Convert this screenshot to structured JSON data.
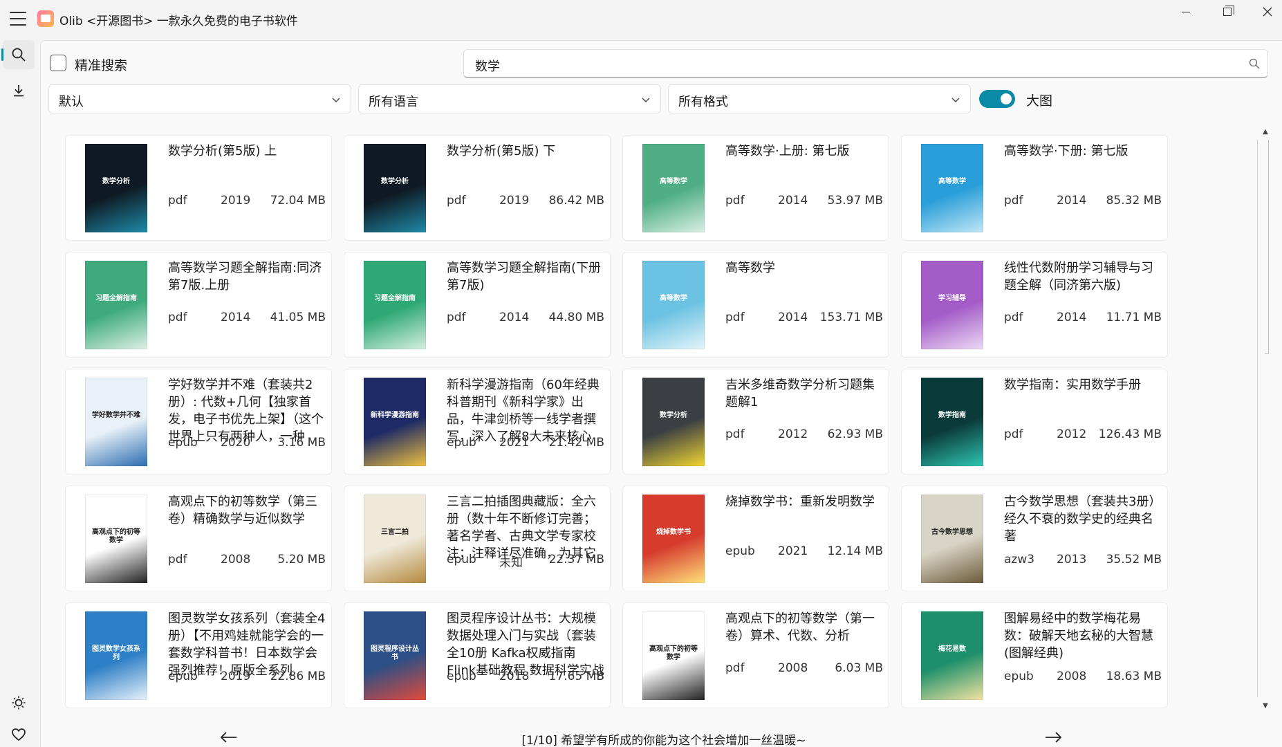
{
  "window": {
    "title": "Olib <开源图书> 一款永久免费的电子书软件",
    "controls": [
      "minimize",
      "maximize",
      "close"
    ]
  },
  "sidebar": {
    "top_items": [
      {
        "icon": "search-icon",
        "active": true
      },
      {
        "icon": "download-icon",
        "active": false
      }
    ],
    "bottom_items": [
      {
        "icon": "theme-icon"
      },
      {
        "icon": "heart-icon"
      },
      {
        "icon": "gear-icon"
      }
    ]
  },
  "filters": {
    "exact_search_label": "精准搜索",
    "exact_search_checked": false,
    "search_value": "数学",
    "sort_selected": "默认",
    "language_selected": "所有语言",
    "format_selected": "所有格式",
    "large_image_label": "大图",
    "large_image_on": true
  },
  "books": [
    {
      "title": "数学分析(第5版) 上",
      "format": "pdf",
      "year": "2019",
      "size": "72.04 MB",
      "cover_color": "#0f1a24",
      "cover_accent": "#1e8aa8",
      "cover_text": "数学分析"
    },
    {
      "title": "数学分析(第5版) 下",
      "format": "pdf",
      "year": "2019",
      "size": "86.42 MB",
      "cover_color": "#0f1a24",
      "cover_accent": "#1e8aa8",
      "cover_text": "数学分析"
    },
    {
      "title": "高等数学·上册: 第七版",
      "format": "pdf",
      "year": "2014",
      "size": "53.97 MB",
      "cover_color": "#4fae84",
      "cover_accent": "#d9efe4",
      "cover_text": "高等数学"
    },
    {
      "title": "高等数学·下册: 第七版",
      "format": "pdf",
      "year": "2014",
      "size": "85.32 MB",
      "cover_color": "#2a9ed8",
      "cover_accent": "#bfe6f6",
      "cover_text": "高等数学"
    },
    {
      "title": "高等数学习题全解指南:同济第7版.上册",
      "format": "pdf",
      "year": "2014",
      "size": "41.05 MB",
      "cover_color": "#3fab7c",
      "cover_accent": "#dff0e7",
      "cover_text": "习题全解指南"
    },
    {
      "title": "高等数学习题全解指南(下册第7版)",
      "format": "pdf",
      "year": "2014",
      "size": "44.80 MB",
      "cover_color": "#2ea874",
      "cover_accent": "#d7efe2",
      "cover_text": "习题全解指南"
    },
    {
      "title": "高等数学",
      "format": "pdf",
      "year": "2014",
      "size": "153.71 MB",
      "cover_color": "#6cc2e2",
      "cover_accent": "#e3f4fa",
      "cover_text": "高等数学"
    },
    {
      "title": "线性代数附册学习辅导与习题全解（同济第六版)",
      "format": "pdf",
      "year": "2014",
      "size": "11.71 MB",
      "cover_color": "#a35cc8",
      "cover_accent": "#ecd9f4",
      "cover_text": "学习辅导"
    },
    {
      "title": "学好数学并不难（套装共2册）: 代数+几何【独家首发，电子书优先上架】（这个世界上只有两种人，一种",
      "format": "epub",
      "year": "2020",
      "size": "3.16 MB",
      "cover_color": "#e9f1f8",
      "cover_accent": "#2b6cb0",
      "cover_text": "学好数学并不难"
    },
    {
      "title": "新科学漫游指南（60年经典科普期刊《新科学家》出品，牛津剑桥等一线学者撰写，深入了解8大未来核心",
      "format": "epub",
      "year": "2021",
      "size": "21.42 MB",
      "cover_color": "#1d2a66",
      "cover_accent": "#f0c040",
      "cover_text": "新科学漫游指南"
    },
    {
      "title": "吉米多维奇数学分析习题集题解1",
      "format": "pdf",
      "year": "2012",
      "size": "62.93 MB",
      "cover_color": "#3b3f44",
      "cover_accent": "#f2d631",
      "cover_text": "数学分析"
    },
    {
      "title": "数学指南：实用数学手册",
      "format": "pdf",
      "year": "2012",
      "size": "126.43 MB",
      "cover_color": "#0b3a3a",
      "cover_accent": "#2fc6b4",
      "cover_text": "数学指南"
    },
    {
      "title": "高观点下的初等数学（第三卷）精确数学与近似数学",
      "format": "pdf",
      "year": "2008",
      "size": "5.20 MB",
      "cover_color": "#ffffff",
      "cover_accent": "#222222",
      "cover_text": "高观点下的初等数学"
    },
    {
      "title": "三言二拍插图典藏版：全六册（数十年不断修订完善；著名学者、古典文学专家校注；注释详尽准确，为其它",
      "format": "epub",
      "year": "未知",
      "size": "22.37 MB",
      "cover_color": "#efe9da",
      "cover_accent": "#b5893d",
      "cover_text": "三言二拍"
    },
    {
      "title": "烧掉数学书：重新发明数学",
      "format": "epub",
      "year": "2021",
      "size": "12.14 MB",
      "cover_color": "#d63b2e",
      "cover_accent": "#ffe27a",
      "cover_text": "烧掉数学书"
    },
    {
      "title": "古今数学思想（套装共3册）经久不衰的数学史的经典名著",
      "format": "azw3",
      "year": "2013",
      "size": "35.52 MB",
      "cover_color": "#d9d5c6",
      "cover_accent": "#6b5a3a",
      "cover_text": "古今数学思想"
    },
    {
      "title": "图灵数学女孩系列（套装全4册）【不用鸡娃就能学会的一套数学科普书！日本数学会强烈推荐！原版全系列",
      "format": "epub",
      "year": "2019",
      "size": "22.86 MB",
      "cover_color": "#2f7fc6",
      "cover_accent": "#e7f2fb",
      "cover_text": "图灵数学女孩系列"
    },
    {
      "title": "图灵程序设计丛书：大规模数据处理入门与实战（套装全10册 Kafka权威指南 Flink基础教程 数据科学实战 SQL",
      "format": "epub",
      "year": "2018",
      "size": "17.65 MB",
      "cover_color": "#2b4f86",
      "cover_accent": "#e24b3a",
      "cover_text": "图灵程序设计丛书"
    },
    {
      "title": "高观点下的初等数学（第一卷）算术、代数、分析",
      "format": "pdf",
      "year": "2008",
      "size": "6.03 MB",
      "cover_color": "#ffffff",
      "cover_accent": "#222222",
      "cover_text": "高观点下的初等数学"
    },
    {
      "title": "图解易经中的数学梅花易数：破解天地玄秘的大智慧 (图解经典)",
      "format": "epub",
      "year": "2008",
      "size": "18.63 MB",
      "cover_color": "#1d8f6a",
      "cover_accent": "#f3e3a2",
      "cover_text": "梅花易数"
    }
  ],
  "pager": {
    "text": "[1/10] 希望学有所成的你能为这个社会增加一丝温暖~",
    "prev_icon": "arrow-left-icon",
    "next_icon": "arrow-right-icon"
  }
}
